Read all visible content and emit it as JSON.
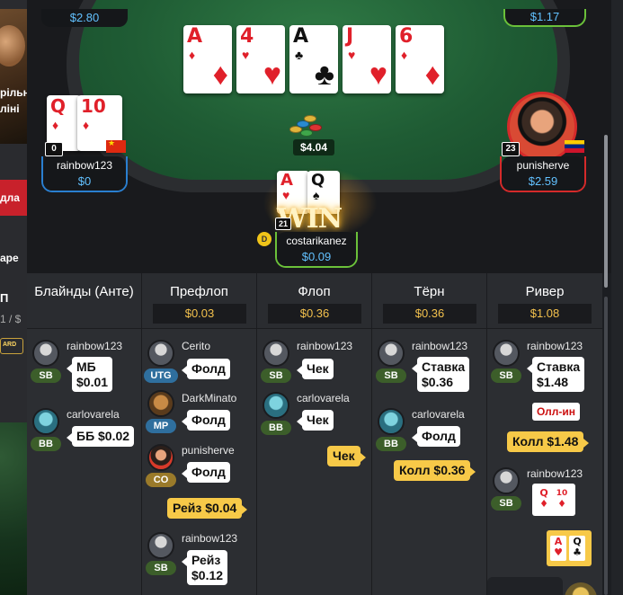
{
  "left_strip": {
    "text1": "рільн",
    "text2": "ліні",
    "text3": "дла",
    "text4": "аре",
    "text5": "П",
    "text6": "1 / $",
    "badge": "ARD"
  },
  "table": {
    "top_left_stack": "$2.80",
    "top_right_stack": "$1.17",
    "board": [
      {
        "rank": "A",
        "suit": "♦",
        "color": "red"
      },
      {
        "rank": "4",
        "suit": "♥",
        "color": "red"
      },
      {
        "rank": "A",
        "suit": "♣",
        "color": "black"
      },
      {
        "rank": "J",
        "suit": "♥",
        "color": "red"
      },
      {
        "rank": "6",
        "suit": "♦",
        "color": "red"
      }
    ],
    "pot": "$4.04",
    "seats": {
      "left": {
        "name": "rainbow123",
        "stack": "$0",
        "count": "0",
        "cards": [
          {
            "rank": "Q",
            "suit": "♦"
          },
          {
            "rank": "10",
            "suit": "♦"
          }
        ]
      },
      "right": {
        "name": "punisherve",
        "stack": "$2.59",
        "count": "23"
      },
      "hero": {
        "name": "costarikanez",
        "stack": "$0.09",
        "count": "21",
        "win": "WIN",
        "dealer": "D",
        "cards": [
          {
            "rank": "A",
            "suit": "♥",
            "color": "red"
          },
          {
            "rank": "Q",
            "suit": "♠",
            "color": "black"
          }
        ]
      }
    }
  },
  "history": {
    "columns": [
      {
        "title": "Блайнды (Анте)",
        "pot": ""
      },
      {
        "title": "Префлоп",
        "pot": "$0.03"
      },
      {
        "title": "Флоп",
        "pot": "$0.36"
      },
      {
        "title": "Тёрн",
        "pot": "$0.36"
      },
      {
        "title": "Ривер",
        "pot": "$1.08"
      }
    ],
    "blinds": [
      {
        "name": "rainbow123",
        "pos": "SB",
        "action1": "МБ",
        "action2": "$0.01"
      },
      {
        "name": "carlovarela",
        "pos": "BB",
        "action": "ББ $0.02"
      }
    ],
    "preflop": [
      {
        "name": "Cerito",
        "pos": "UTG",
        "action": "Фолд"
      },
      {
        "name": "DarkMinato",
        "pos": "MP",
        "action": "Фолд"
      },
      {
        "name": "punisherve",
        "pos": "CO",
        "action": "Фолд"
      },
      {
        "hero_action": "Рейз $0.04"
      },
      {
        "name": "rainbow123",
        "pos": "SB",
        "action1": "Рейз",
        "action2": "$0.12"
      }
    ],
    "flop": [
      {
        "name": "rainbow123",
        "pos": "SB",
        "action": "Чек"
      },
      {
        "name": "carlovarela",
        "pos": "BB",
        "action": "Чек"
      },
      {
        "hero_action": "Чек"
      }
    ],
    "turn": [
      {
        "name": "rainbow123",
        "pos": "SB",
        "action1": "Ставка",
        "action2": "$0.36"
      },
      {
        "name": "carlovarela",
        "pos": "BB",
        "action": "Фолд"
      },
      {
        "hero_action": "Колл $0.36"
      }
    ],
    "river": [
      {
        "name": "rainbow123",
        "pos": "SB",
        "action1": "Ставка",
        "action2": "$1.48"
      },
      {
        "allin": "Олл-ин"
      },
      {
        "hero_action": "Колл $1.48"
      },
      {
        "name": "rainbow123",
        "pos": "SB",
        "cards": [
          {
            "rank": "Q",
            "suit": "♦"
          },
          {
            "rank": "10",
            "suit": "♦"
          }
        ]
      },
      {
        "hero_cards": [
          {
            "rank": "A",
            "suit": "♥"
          },
          {
            "rank": "Q",
            "suit": "♣"
          }
        ]
      }
    ]
  },
  "colors": {
    "felt": "#1f5c34",
    "stack_blue": "#62c1ff",
    "pot_gold": "#f3c14d",
    "action_yellow": "#f7c948",
    "seat_blue": "#2a7fd0",
    "seat_red": "#d52a2a",
    "seat_green": "#6bc13a"
  }
}
